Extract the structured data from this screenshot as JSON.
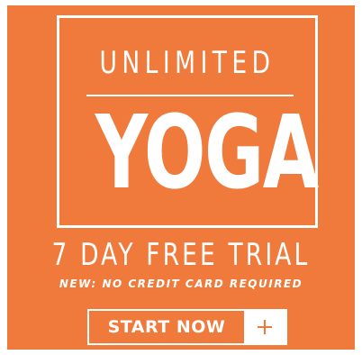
{
  "ad": {
    "headline_top": "UNLIMITED",
    "headline_main": "YOGA",
    "trial": "7 DAY FREE TRIAL",
    "subnote": "NEW: NO CREDIT CARD REQUIRED",
    "cta_label": "START NOW",
    "cta_icon": "plus-icon"
  },
  "colors": {
    "background": "#ef7a3b",
    "text": "#ffffff"
  }
}
